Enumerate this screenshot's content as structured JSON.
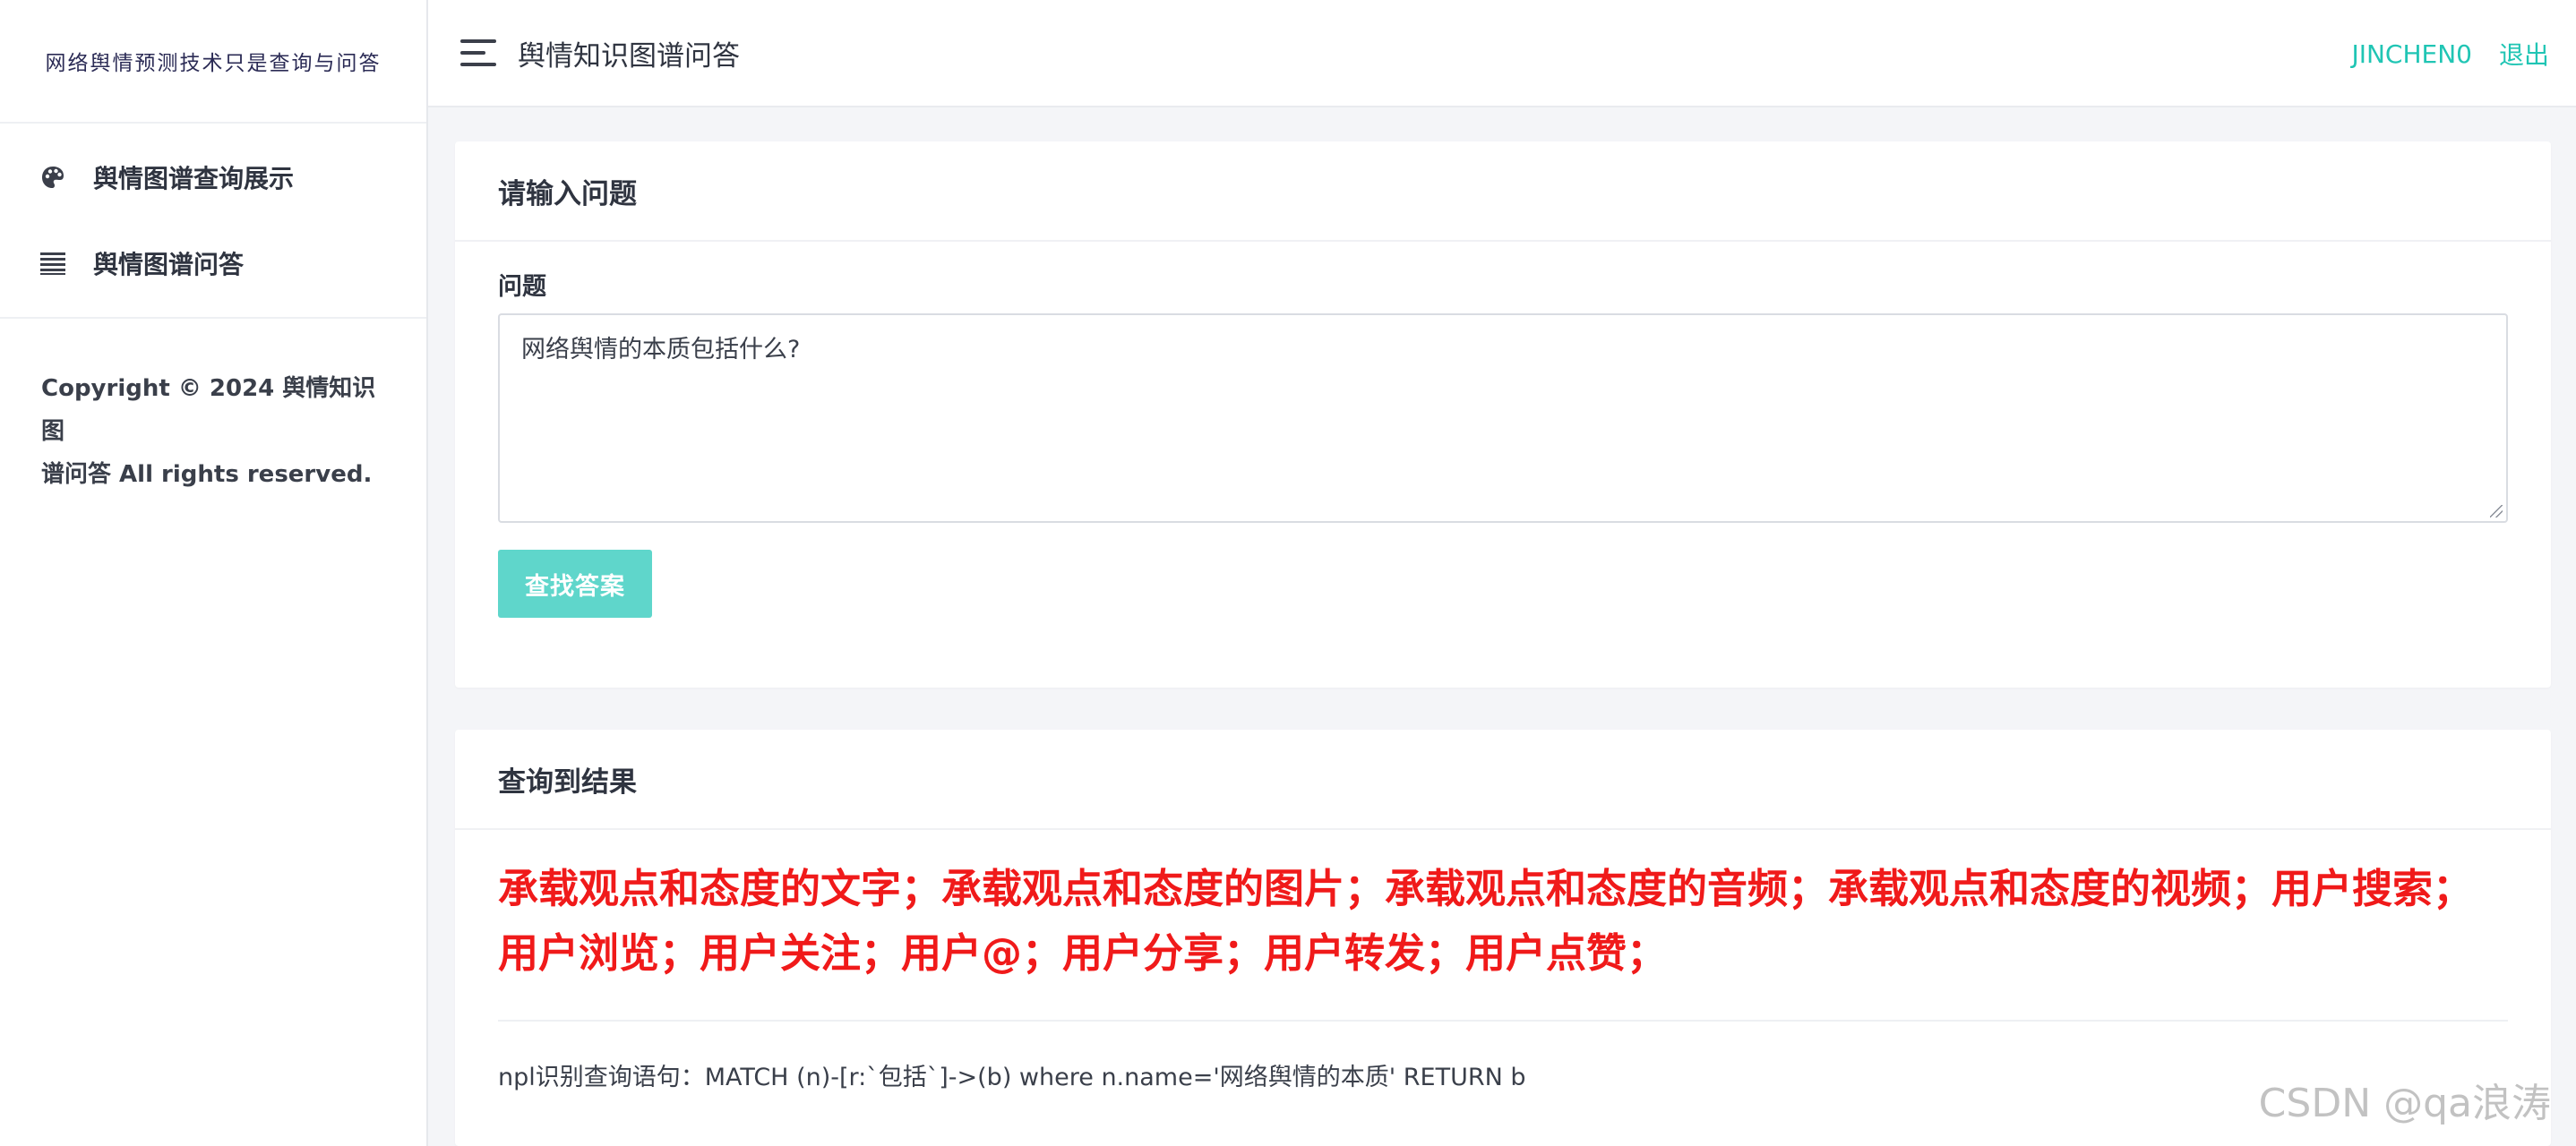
{
  "sidebar": {
    "brand": "网络舆情预测技术只是查询与问答",
    "items": [
      {
        "label": "舆情图谱查询展示",
        "icon": "palette-icon"
      },
      {
        "label": "舆情图谱问答",
        "icon": "list-icon"
      }
    ],
    "copyright_line1": "Copyright © 2024 舆情知识图",
    "copyright_line2": "谱问答 All rights reserved."
  },
  "header": {
    "title": "舆情知识图谱问答",
    "user": "JINCHEN0",
    "logout": "退出"
  },
  "question_card": {
    "title": "请输入问题",
    "field_label": "问题",
    "question_value": "网络舆情的本质包括什么?",
    "button_label": "查找答案"
  },
  "result_card": {
    "title": "查询到结果",
    "answer": "承载观点和态度的文字；承载观点和态度的图片；承载观点和态度的音频；承载观点和态度的视频；用户搜索；用户浏览；用户关注；用户@；用户分享；用户转发；用户点赞；",
    "npl_line": "npl识别查询语句：MATCH (n)-[r:`包括`]->(b) where n.name='网络舆情的本质' RETURN b"
  },
  "watermark": "CSDN @qa浪涛",
  "colors": {
    "accent": "#20c5b4",
    "button": "#5fd6cb",
    "answer": "#f01a1a"
  }
}
